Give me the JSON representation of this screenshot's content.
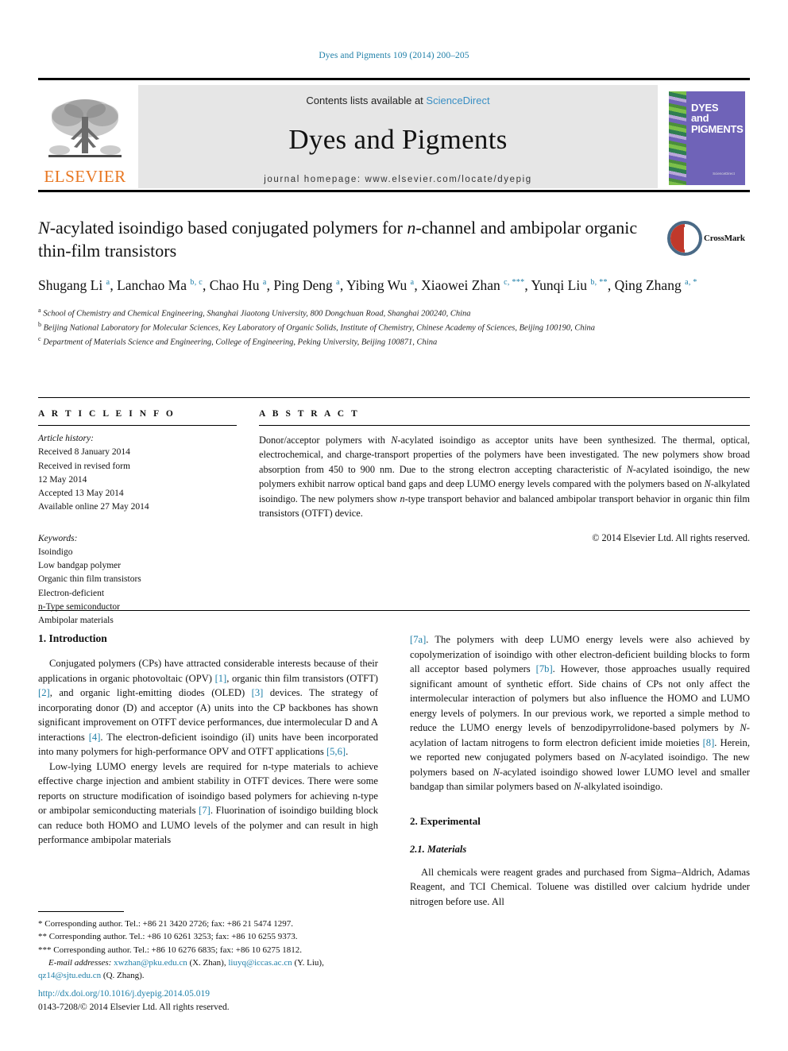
{
  "running_head": "Dyes and Pigments 109 (2014) 200–205",
  "masthead": {
    "contents_prefix": "Contents lists available at ",
    "sciencedirect": "ScienceDirect",
    "journal_name": "Dyes and Pigments",
    "homepage": "journal homepage: www.elsevier.com/locate/dyepig",
    "publisher_logo_text": "ELSEVIER",
    "cover_title_line1": "DYES",
    "cover_title_line2": "and",
    "cover_title_line3": "PIGMENTS",
    "cover_footer": "Available online at\nScienceDirect\nwww.sciencedirect.com"
  },
  "article": {
    "title_part1": "N",
    "title_rest": "-acylated isoindigo based conjugated polymers for ",
    "title_n2": "n",
    "title_tail": "-channel and ambipolar organic thin-film transistors",
    "crossmark_label": "CrossMark",
    "authors": [
      {
        "name": "Shugang Li",
        "sup": "a",
        "sep": ", "
      },
      {
        "name": "Lanchao Ma",
        "sup": "b, c",
        "sep": ", "
      },
      {
        "name": "Chao Hu",
        "sup": "a",
        "sep": ", "
      },
      {
        "name": "Ping Deng",
        "sup": "a",
        "sep": ", "
      },
      {
        "name": "Yibing Wu",
        "sup": "a",
        "sep": ", "
      },
      {
        "name": "Xiaowei Zhan",
        "sup": "c, ***",
        "sep": ", "
      },
      {
        "name": "Yunqi Liu",
        "sup": "b, **",
        "sep": ", "
      },
      {
        "name": "Qing Zhang",
        "sup": "a, *",
        "sep": ""
      }
    ],
    "affiliations": [
      {
        "mark": "a",
        "text": "School of Chemistry and Chemical Engineering, Shanghai Jiaotong University, 800 Dongchuan Road, Shanghai 200240, China"
      },
      {
        "mark": "b",
        "text": "Beijing National Laboratory for Molecular Sciences, Key Laboratory of Organic Solids, Institute of Chemistry, Chinese Academy of Sciences, Beijing 100190, China"
      },
      {
        "mark": "c",
        "text": "Department of Materials Science and Engineering, College of Engineering, Peking University, Beijing 100871, China"
      }
    ]
  },
  "article_info": {
    "heading": "A R T I C L E   I N F O",
    "history_label": "Article history:",
    "history": [
      "Received 8 January 2014",
      "Received in revised form",
      "12 May 2014",
      "Accepted 13 May 2014",
      "Available online 27 May 2014"
    ],
    "keywords_label": "Keywords:",
    "keywords": [
      "Isoindigo",
      "Low bandgap polymer",
      "Organic thin film transistors",
      "Electron-deficient",
      "n-Type semiconductor",
      "Ambipolar materials"
    ]
  },
  "abstract": {
    "heading": "A B S T R A C T",
    "body_1": "Donor/acceptor polymers with ",
    "body_i1": "N",
    "body_2": "-acylated isoindigo as acceptor units have been synthesized. The thermal, optical, electrochemical, and charge-transport properties of the polymers have been investigated. The new polymers show broad absorption from 450 to 900 nm. Due to the strong electron accepting characteristic of ",
    "body_i2": "N",
    "body_3": "-acylated isoindigo, the new polymers exhibit narrow optical band gaps and deep LUMO energy levels compared with the polymers based on ",
    "body_i3": "N",
    "body_4": "-alkylated isoindigo. The new polymers show ",
    "body_i4": "n",
    "body_5": "-type transport behavior and balanced ambipolar transport behavior in organic thin film transistors (OTFT) device.",
    "copyright": "© 2014 Elsevier Ltd. All rights reserved."
  },
  "sections": {
    "intro_heading": "1. Introduction",
    "experimental_heading": "2. Experimental",
    "materials_heading": "2.1. Materials"
  },
  "body": {
    "p1_a": "Conjugated polymers (CPs) have attracted considerable interests because of their applications in organic photovoltaic (OPV) ",
    "p1_r1": "[1]",
    "p1_b": ", organic thin film transistors (OTFT) ",
    "p1_r2": "[2]",
    "p1_c": ", and organic light-emitting diodes (OLED) ",
    "p1_r3": "[3]",
    "p1_d": " devices. The strategy of incorporating donor (D) and acceptor (A) units into the CP backbones has shown significant improvement on OTFT device performances, due intermolecular D and A interactions ",
    "p1_r4": "[4]",
    "p1_e": ". The electron-deficient isoindigo (iI) units have been incorporated into many polymers for high-performance OPV and OTFT applications ",
    "p1_r5": "[5,6]",
    "p1_f": ".",
    "p2_a": "Low-lying LUMO energy levels are required for n-type materials to achieve effective charge injection and ambient stability in OTFT devices. There were some reports on structure modification of isoindigo based polymers for achieving n-type or ambipolar semiconducting materials ",
    "p2_r1": "[7]",
    "p2_b": ". Fluorination of isoindigo building block can reduce both HOMO and LUMO levels of the polymer and can result in high performance ambipolar materials ",
    "p2_r2": "[7a]",
    "p2_c": ". The polymers with deep LUMO energy levels were also achieved by copolymerization of isoindigo with other electron-deficient building blocks to form all acceptor based polymers ",
    "p2_r3": "[7b]",
    "p2_d": ". However, those approaches usually required significant amount of synthetic effort. Side chains of CPs not only affect the intermolecular interaction of polymers but also influence the HOMO and LUMO energy levels of polymers. In our previous work, we reported a simple method to reduce the LUMO energy levels of benzodipyrrolidone-based polymers by ",
    "p2_i1": "N",
    "p2_e": "-acylation of lactam nitrogens to form electron deficient imide moieties ",
    "p2_r4": "[8]",
    "p2_f": ". Herein, we reported new conjugated polymers based on ",
    "p2_i2": "N",
    "p2_g": "-acylated isoindigo. The new polymers based on ",
    "p2_i3": "N",
    "p2_h": "-acylated isoindigo showed lower LUMO level and smaller bandgap than similar polymers based on ",
    "p2_i4": "N",
    "p2_i": "-alkylated isoindigo.",
    "p3_a": "All chemicals were reagent grades and purchased from Sigma–Aldrich, Adamas Reagent, and TCI Chemical. Toluene was distilled over calcium hydride under nitrogen before use. All"
  },
  "footnotes": {
    "fn1": "* Corresponding author. Tel.: +86 21 3420 2726; fax: +86 21 5474 1297.",
    "fn2": "** Corresponding author. Tel.: +86 10 6261 3253; fax: +86 10 6255 9373.",
    "fn3": "*** Corresponding author. Tel.: +86 10 6276 6835; fax: +86 10 6275 1812.",
    "email_label": "E-mail addresses:",
    "email1": "xwzhan@pku.edu.cn",
    "email1_who": " (X. Zhan), ",
    "email2": "liuyq@iccas.ac.cn",
    "email2_who": " (Y. Liu), ",
    "email3": "qz14@sjtu.edu.cn",
    "email3_who": " (Q. Zhang)."
  },
  "footer": {
    "doi": "http://dx.doi.org/10.1016/j.dyepig.2014.05.019",
    "issn": "0143-7208/© 2014 Elsevier Ltd. All rights reserved."
  },
  "colors": {
    "link": "#1f7fa8",
    "elsevier_orange": "#E87722",
    "band_gray": "#e6e6e6",
    "cover_purple": "#6f63b8"
  }
}
